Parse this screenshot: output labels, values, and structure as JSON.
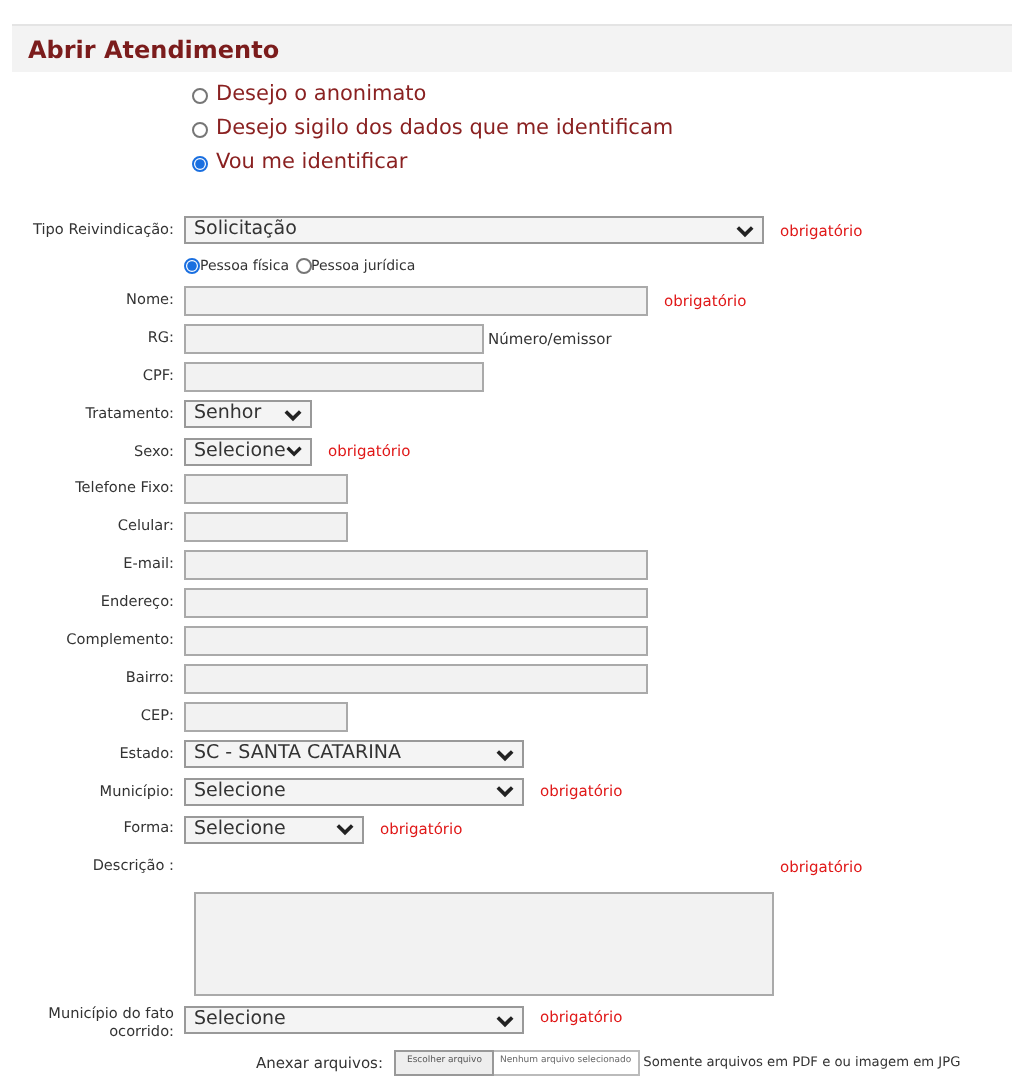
{
  "header": {
    "title": "Abrir Atendimento"
  },
  "identity_options": [
    {
      "label": "Desejo o anonimato",
      "selected": false
    },
    {
      "label": "Desejo sigilo dos dados que me identificam",
      "selected": false
    },
    {
      "label": "Vou me identificar",
      "selected": true
    }
  ],
  "form_rows": [
    {
      "kind": "select",
      "label": "Tipo Reivindicação:",
      "value": "Solicitação",
      "required": "obrigatório"
    },
    {
      "kind": "radios",
      "options": [
        {
          "label": "Pessoa física",
          "selected": true
        },
        {
          "label": "Pessoa jurídica",
          "selected": false
        }
      ]
    },
    {
      "kind": "text",
      "label": "Nome:",
      "required": "obrigatório"
    },
    {
      "kind": "text",
      "label": "RG:",
      "hint": "Número/emissor"
    },
    {
      "kind": "text",
      "label": "CPF:"
    },
    {
      "kind": "select",
      "label": "Tratamento:",
      "value": "Senhor"
    },
    {
      "kind": "select",
      "label": "Sexo:",
      "value": "Selecione",
      "required": "obrigatório"
    },
    {
      "kind": "text",
      "label": "Telefone Fixo:"
    },
    {
      "kind": "text",
      "label": "Celular:"
    },
    {
      "kind": "text",
      "label": "E-mail:"
    },
    {
      "kind": "text",
      "label": "Endereço:"
    },
    {
      "kind": "text",
      "label": "Complemento:"
    },
    {
      "kind": "text",
      "label": "Bairro:"
    },
    {
      "kind": "text",
      "label": "CEP:"
    },
    {
      "kind": "select",
      "label": "Estado:",
      "value": "SC - SANTA CATARINA"
    },
    {
      "kind": "select",
      "label": "Município:",
      "value": "Selecione",
      "required": "obrigatório"
    },
    {
      "kind": "select",
      "label": "Forma:",
      "value": "Selecione",
      "required": "obrigatório"
    },
    {
      "kind": "textarea",
      "label": "Descrição :",
      "required": "obrigatório"
    },
    {
      "kind": "select",
      "label": "Município do fato ocorrido:",
      "value": "Selecione",
      "required": "obrigatório"
    },
    {
      "kind": "file",
      "label": "Anexar arquivos:",
      "button": "Escolher arquivo",
      "status": "Nenhum arquivo selecionado",
      "hint": "Somente arquivos em PDF e ou imagem em JPG"
    }
  ]
}
